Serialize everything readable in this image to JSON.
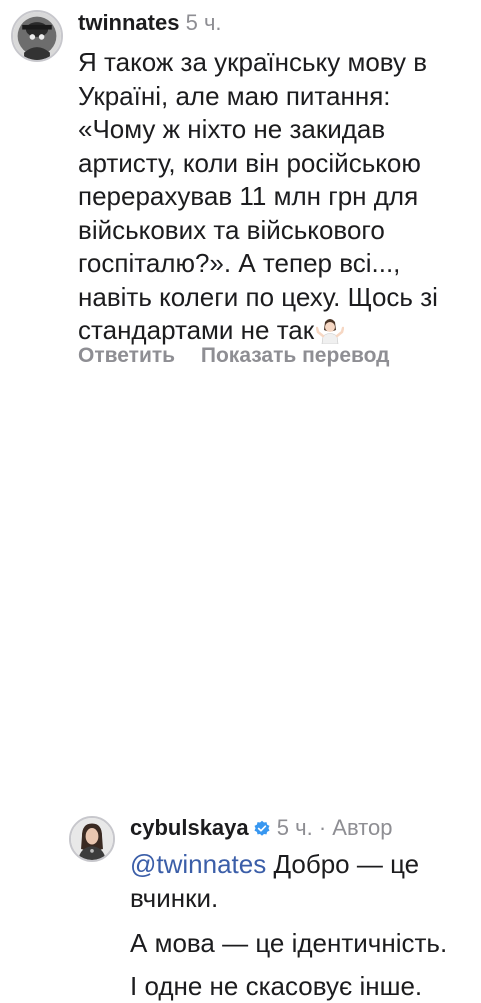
{
  "comment1": {
    "username": "twinnates",
    "time": "5 ч.",
    "lines": [
      "Я також за українську мову в",
      "Україні, але маю питання:",
      "«Чому ж ніхто не закидав",
      "артисту, коли він російською",
      "перерахував 11 млн грн для",
      "військових та військового",
      "госпіталю?». А тепер всі...,",
      "навіть колеги по цеху. Щось зі",
      "стандартами не так"
    ],
    "emoji": "person-shrugging-emoji",
    "reply_label": "Ответить",
    "translate_label": "Показать перевод"
  },
  "comment2": {
    "username": "cybulskaya",
    "verified_icon": "verified-badge-icon",
    "time": "5 ч.",
    "separator": "·",
    "author_label": "Автор",
    "mention": "@twinnates",
    "line1_rest": " Добро — це",
    "line2": "вчинки.",
    "line3": "А мова — це ідентичність.",
    "line4": "І одне не скасовує інше."
  },
  "colors": {
    "text": "#1c1c1e",
    "meta": "#8e8e93",
    "mention": "#3b5ea8",
    "verified": "#3897f0"
  }
}
